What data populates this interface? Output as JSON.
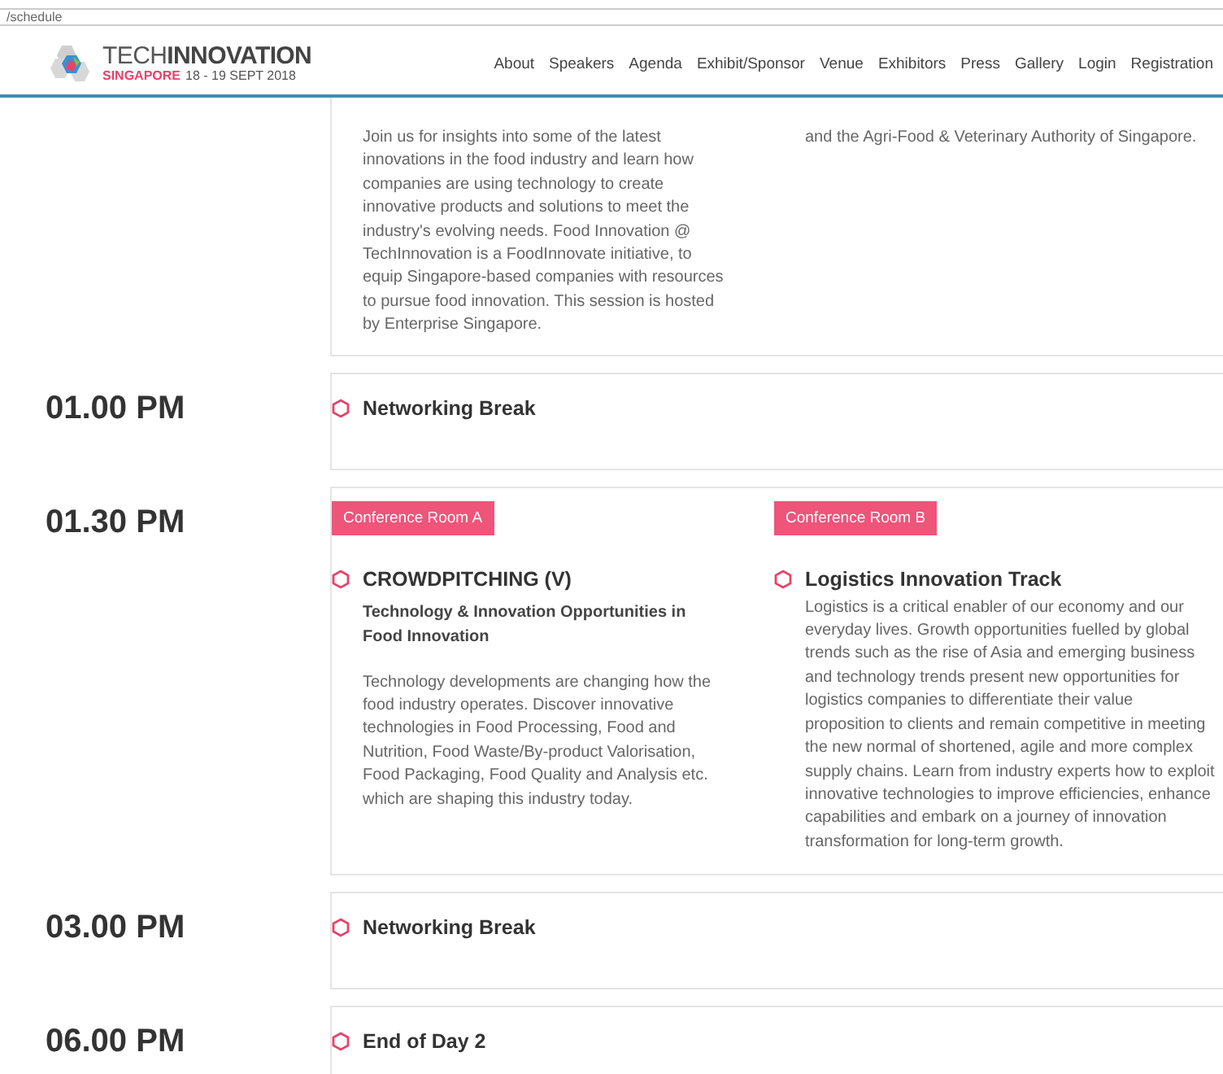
{
  "address_bar": {
    "url": "/schedule"
  },
  "header": {
    "logo": {
      "title": "TECH**INNOVATION**",
      "place": "SINGAPORE",
      "dates": "18 - 19 SEPT 2018"
    },
    "nav": [
      "About",
      "Speakers",
      "Agenda",
      "Exhibit/Sponsor",
      "Venue",
      "Exhibitors",
      "Press",
      "Gallery",
      "Login",
      "Registration"
    ]
  },
  "schedule": [
    {
      "sessions": [
        {
          "paragraphs": [
            "Join us for insights into some of the latest innovations in the food industry and learn how companies are using technology to create innovative products and solutions to meet the industry's evolving needs. Food Innovation @ TechInnovation is a FoodInnovate initiative, to equip Singapore-based companies with resources to pursue food innovation. This session is hosted by Enterprise Singapore."
          ]
        },
        {
          "paragraphs": [
            "and the Agri-Food & Veterinary Authority of Singapore."
          ]
        }
      ]
    },
    {
      "time": "01.00 PM",
      "sessions": [
        {
          "title": "Networking Break"
        }
      ]
    },
    {
      "time": "01.30 PM",
      "sessions": [
        {
          "room": "Conference Room A",
          "title": "CROWDPITCHING (V)",
          "subtitle": "Technology & Innovation Opportunities in Food Innovation",
          "paragraphs": [
            "Technology developments are changing how the food industry operates. Discover innovative technologies in Food Processing, Food and Nutrition, Food Waste/By-product Valorisation, Food Packaging, Food Quality and Analysis etc. which are shaping this industry today."
          ]
        },
        {
          "room": "Conference Room B",
          "title": "Logistics Innovation Track",
          "paragraphs": [
            "Logistics is a critical enabler of our economy and our everyday lives. Growth opportunities fuelled by global trends such as the rise of Asia and emerging business and technology trends present new opportunities for logistics companies to differentiate their value proposition to clients and remain competitive in meeting the new normal of shortened, agile and more complex supply chains. Learn from industry experts how to exploit innovative technologies to improve efficiencies, enhance capabilities and embark on a journey of innovation transformation for long-term growth."
          ]
        }
      ]
    },
    {
      "time": "03.00 PM",
      "sessions": [
        {
          "title": "Networking Break"
        }
      ]
    },
    {
      "time": "06.00 PM",
      "sessions": [
        {
          "title": "End of Day 2"
        }
      ]
    }
  ]
}
